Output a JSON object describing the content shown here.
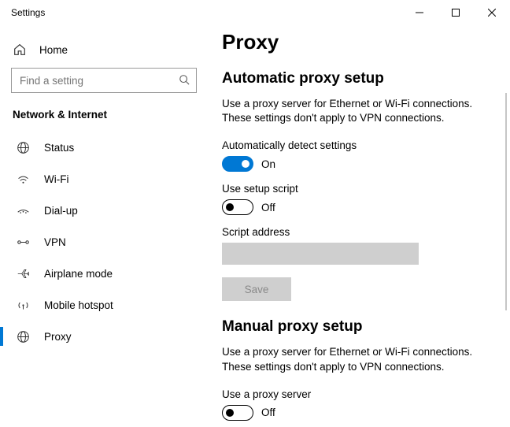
{
  "window": {
    "title": "Settings"
  },
  "sidebar": {
    "home": "Home",
    "search_placeholder": "Find a setting",
    "category": "Network & Internet",
    "items": [
      {
        "label": "Status"
      },
      {
        "label": "Wi-Fi"
      },
      {
        "label": "Dial-up"
      },
      {
        "label": "VPN"
      },
      {
        "label": "Airplane mode"
      },
      {
        "label": "Mobile hotspot"
      },
      {
        "label": "Proxy"
      }
    ]
  },
  "page": {
    "title": "Proxy",
    "auto": {
      "heading": "Automatic proxy setup",
      "desc": "Use a proxy server for Ethernet or Wi-Fi connections. These settings don't apply to VPN connections.",
      "detect_label": "Automatically detect settings",
      "detect_state": "On",
      "script_label": "Use setup script",
      "script_state": "Off",
      "addr_label": "Script address",
      "save": "Save"
    },
    "manual": {
      "heading": "Manual proxy setup",
      "desc": "Use a proxy server for Ethernet or Wi-Fi connections. These settings don't apply to VPN connections.",
      "use_label": "Use a proxy server",
      "use_state": "Off"
    }
  }
}
